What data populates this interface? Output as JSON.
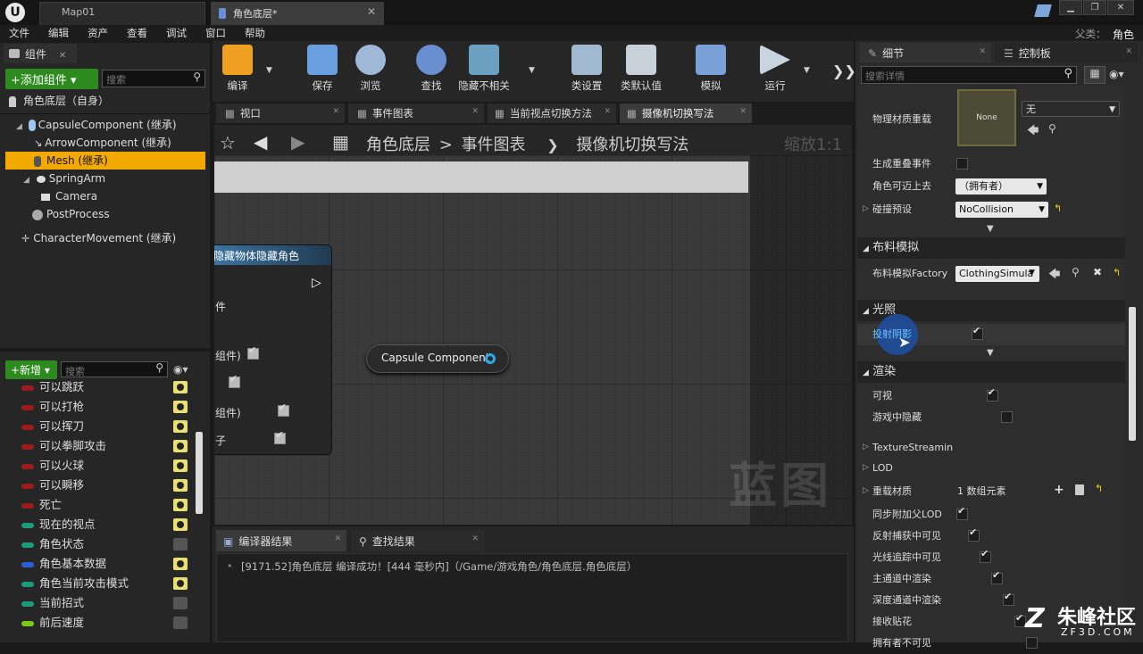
{
  "titlebar": {
    "tabs": [
      {
        "label": "Map01"
      },
      {
        "label": "角色底层*"
      }
    ],
    "parent_label": "父类：",
    "parent_value": "角色"
  },
  "menu": [
    "文件",
    "编辑",
    "资产",
    "查看",
    "调试",
    "窗口",
    "帮助"
  ],
  "components_panel": {
    "title": "组件",
    "add_button": "+添加组件 ▾",
    "search_placeholder": "搜索",
    "root": "角色底层（自身）",
    "tree": [
      {
        "label": "CapsuleComponent (继承)",
        "icon": "capsule-icon"
      },
      {
        "label": "ArrowComponent (继承)",
        "icon": "arrow-icon"
      },
      {
        "label": "Mesh (继承)",
        "icon": "mesh-icon",
        "selected": true
      },
      {
        "label": "SpringArm",
        "icon": "spring-arm-icon"
      },
      {
        "label": "Camera",
        "icon": "camera-icon"
      },
      {
        "label": "PostProcess",
        "icon": "postprocess-icon"
      },
      {
        "label": "CharacterMovement (继承)",
        "icon": "movement-icon"
      }
    ]
  },
  "myblueprint": {
    "new_button": "+新增 ▾",
    "search_placeholder": "搜索",
    "variables": [
      {
        "label": "可以跳跃",
        "color": "#9b1c1c",
        "eye": true
      },
      {
        "label": "可以打枪",
        "color": "#9b1c1c",
        "eye": true
      },
      {
        "label": "可以挥刀",
        "color": "#9b1c1c",
        "eye": true
      },
      {
        "label": "可以拳脚攻击",
        "color": "#9b1c1c",
        "eye": true
      },
      {
        "label": "可以火球",
        "color": "#9b1c1c",
        "eye": true
      },
      {
        "label": "可以瞬移",
        "color": "#9b1c1c",
        "eye": true
      },
      {
        "label": "死亡",
        "color": "#9b1c1c",
        "eye": true
      },
      {
        "label": "现在的视点",
        "color": "#1b9a7c",
        "eye": true
      },
      {
        "label": "角色状态",
        "color": "#1b9a7c",
        "eye": false
      },
      {
        "label": "角色基本数据",
        "color": "#2a5fd6",
        "eye": true
      },
      {
        "label": "角色当前攻击模式",
        "color": "#1b9a7c",
        "eye": true
      },
      {
        "label": "当前招式",
        "color": "#1b9a7c",
        "eye": false
      },
      {
        "label": "前后速度",
        "color": "#7ec81e",
        "eye": false
      }
    ]
  },
  "toolbar": {
    "buttons": [
      {
        "label": "编译",
        "icon": "compile-icon"
      },
      {
        "label": "保存",
        "icon": "save-icon"
      },
      {
        "label": "浏览",
        "icon": "browse-icon"
      },
      {
        "label": "查找",
        "icon": "find-icon"
      },
      {
        "label": "隐藏不相关",
        "icon": "hide-unrelated-icon"
      },
      {
        "label": "类设置",
        "icon": "class-settings-icon"
      },
      {
        "label": "类默认值",
        "icon": "class-defaults-icon"
      },
      {
        "label": "模拟",
        "icon": "simulate-icon"
      },
      {
        "label": "运行",
        "icon": "play-icon"
      }
    ]
  },
  "editor_tabs": [
    {
      "label": "视口"
    },
    {
      "label": "事件图表"
    },
    {
      "label": "当前视点切换方法"
    },
    {
      "label": "摄像机切换写法",
      "active": true
    }
  ],
  "breadcrumb": {
    "items": [
      "角色底层",
      "事件图表",
      "摄像机切换写法"
    ],
    "separator": ">",
    "zoom": "缩放1:1"
  },
  "graph": {
    "node_title": "隐藏物体隐藏角色",
    "node_rows": [
      "件",
      "组件)",
      "",
      "组件)",
      "子"
    ],
    "capsule_node": "Capsule Component",
    "watermark": "蓝图"
  },
  "bottom": {
    "tabs": [
      "编译器结果",
      "查找结果"
    ],
    "log": "[9171.52]角色底层 编译成功！[444 毫秒内]（/Game/游戏角色/角色底层.角色底层）"
  },
  "details": {
    "tabs": [
      "细节",
      "控制板"
    ],
    "search_placeholder": "搜索详情",
    "phys_material_label": "物理材质重载",
    "phys_material_thumb": "None",
    "phys_material_combo": "无",
    "rows1": [
      {
        "label": "生成重叠事件",
        "checked": false
      },
      {
        "label": "角色可迈上去",
        "combo": "（拥有者）"
      },
      {
        "label": "碰撞预设",
        "combo": "NoCollision"
      }
    ],
    "cloth_section": "布料模拟",
    "cloth_factory_label": "布料模拟Factory",
    "cloth_factory_value": "ClothingSimula",
    "lighting_section": "光照",
    "cast_shadow": "投射阴影",
    "render_section": "渲染",
    "render_rows": [
      {
        "label": "可视",
        "checked": true
      },
      {
        "label": "游戏中隐藏",
        "checked": false
      }
    ],
    "collapsed": [
      "TextureStreamin",
      "LOD"
    ],
    "override_material": "重载材质",
    "override_material_value": "1 数组元素",
    "more_rows": [
      {
        "label": "同步附加父LOD",
        "checked": true
      },
      {
        "label": "反射捕获中可见",
        "checked": true
      },
      {
        "label": "光线追踪中可见",
        "checked": true
      },
      {
        "label": "主通道中渲染",
        "checked": true
      },
      {
        "label": "深度通道中渲染",
        "checked": true
      },
      {
        "label": "接收贴花",
        "checked": true
      },
      {
        "label": "拥有者不可见",
        "checked": false
      }
    ]
  },
  "brand": {
    "name": "朱峰社区",
    "url": "ZF3D.COM"
  }
}
